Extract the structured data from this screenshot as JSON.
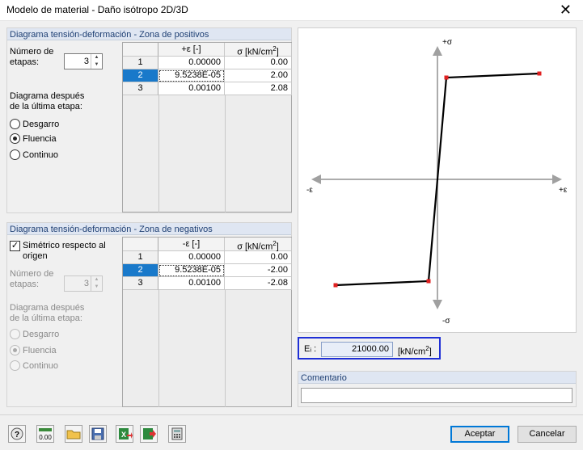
{
  "window": {
    "title": "Modelo de material - Daño isótropo 2D/3D"
  },
  "positive": {
    "header": "Diagrama tensión-deformación - Zona de positivos",
    "steps_label_1": "Número de",
    "steps_label_2": "etapas:",
    "steps_value": "3",
    "after_label_1": "Diagrama después",
    "after_label_2": "de la última etapa:",
    "options": [
      "Desgarro",
      "Fluencia",
      "Continuo"
    ],
    "selected_option": "Fluencia",
    "col_eps": "+ε [-]",
    "col_sigma": "σ [kN/cm2]",
    "rows": [
      {
        "n": "1",
        "eps": "0.00000",
        "sigma": "0.00"
      },
      {
        "n": "2",
        "eps": "9.5238E-05",
        "sigma": "2.00"
      },
      {
        "n": "3",
        "eps": "0.00100",
        "sigma": "2.08"
      }
    ]
  },
  "negative": {
    "header": "Diagrama tensión-deformación - Zona de negativos",
    "symmetric_label_1": "Simétrico respecto al",
    "symmetric_label_2": "origen",
    "symmetric_checked": true,
    "steps_label_1": "Número de",
    "steps_label_2": "etapas:",
    "steps_value": "3",
    "after_label_1": "Diagrama después",
    "after_label_2": "de la última etapa:",
    "options": [
      "Desgarro",
      "Fluencia",
      "Continuo"
    ],
    "selected_option": "Fluencia",
    "col_eps": "-ε [-]",
    "col_sigma": "σ [kN/cm2]",
    "rows": [
      {
        "n": "1",
        "eps": "0.00000",
        "sigma": "0.00"
      },
      {
        "n": "2",
        "eps": "9.5238E-05",
        "sigma": "-2.00"
      },
      {
        "n": "3",
        "eps": "0.00100",
        "sigma": "-2.08"
      }
    ]
  },
  "chart": {
    "pos_y": "+σ",
    "neg_y": "-σ",
    "neg_x": "-ε",
    "pos_x": "+ε"
  },
  "chart_data": {
    "type": "line",
    "series": [
      {
        "x": [
          -0.001,
          -9.5238e-05,
          0.0,
          9.5238e-05,
          0.001
        ],
        "y": [
          -2.08,
          -2.0,
          0.0,
          2.0,
          2.08
        ]
      }
    ],
    "xlabel": "ε",
    "ylabel": "σ"
  },
  "ei": {
    "label": "Eᵢ :",
    "value": "21000.00",
    "unit": "[kN/cm2]"
  },
  "comment": {
    "label": "Comentario",
    "value": ""
  },
  "toolbar_icons": [
    "help-icon",
    "units-icon",
    "open-folder-icon",
    "save-icon",
    "export-excel-icon",
    "import-icon",
    "calculator-icon"
  ],
  "buttons": {
    "accept": "Aceptar",
    "cancel": "Cancelar"
  },
  "colors": {
    "accent": "#1979ca",
    "highlight_border": "#1f2fd6",
    "point": "#e02020"
  }
}
